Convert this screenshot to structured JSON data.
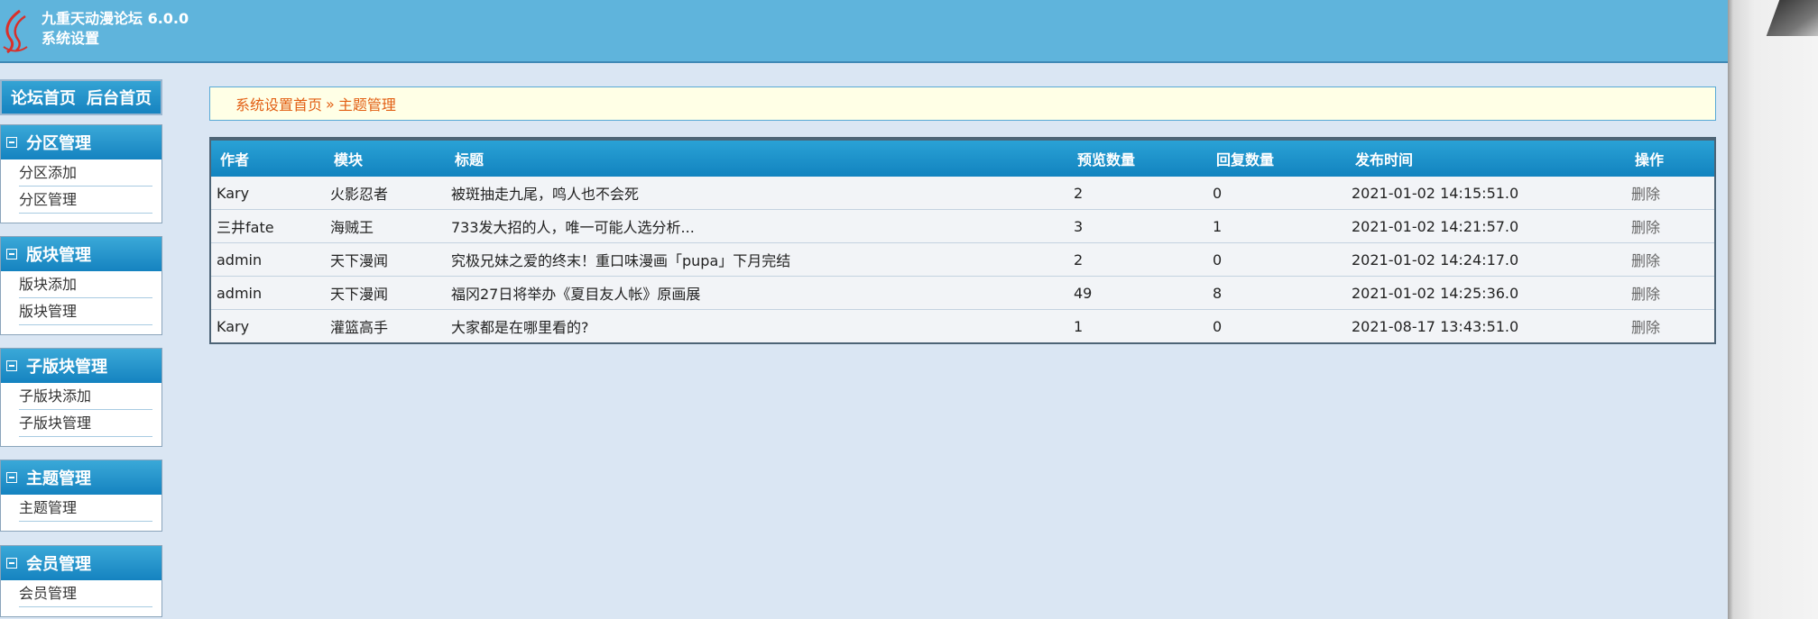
{
  "header": {
    "app_name": "九重天动漫论坛 6.0.0",
    "subtitle": "系统设置"
  },
  "top_links": [
    "论坛首页",
    "后台首页"
  ],
  "sidebar": {
    "groups": [
      {
        "title": "分区管理",
        "items": [
          "分区添加",
          "分区管理"
        ]
      },
      {
        "title": "版块管理",
        "items": [
          "版块添加",
          "版块管理"
        ]
      },
      {
        "title": "子版块管理",
        "items": [
          "子版块添加",
          "子版块管理"
        ]
      },
      {
        "title": "主题管理",
        "items": [
          "主题管理"
        ]
      },
      {
        "title": "会员管理",
        "items": [
          "会员管理"
        ]
      }
    ]
  },
  "breadcrumb": {
    "home": "系统设置首页",
    "separator": "»",
    "current": "主题管理"
  },
  "table": {
    "headers": [
      "作者",
      "模块",
      "标题",
      "预览数量",
      "回复数量",
      "发布时间",
      "操作"
    ],
    "rows": [
      [
        "Kary",
        "火影忍者",
        "被斑抽走九尾，鸣人也不会死",
        "2",
        "0",
        "2021-01-02 14:15:51.0",
        "删除"
      ],
      [
        "三井fate",
        "海贼王",
        "733发大招的人，唯一可能人选分析...",
        "3",
        "1",
        "2021-01-02 14:21:57.0",
        "删除"
      ],
      [
        "admin",
        "天下漫闻",
        "究极兄妹之爱的终末！重口味漫画「pupa」下月完结",
        "2",
        "0",
        "2021-01-02 14:24:17.0",
        "删除"
      ],
      [
        "admin",
        "天下漫闻",
        "福冈27日将举办《夏目友人帐》原画展",
        "49",
        "8",
        "2021-01-02 14:25:36.0",
        "删除"
      ],
      [
        "Kary",
        "灌篮高手",
        "大家都是在哪里看的?",
        "1",
        "0",
        "2021-08-17 13:43:51.0",
        "删除"
      ]
    ]
  },
  "colors": {
    "header_bg": "#5fb4dc",
    "page_bg": "#dae6f3",
    "accent_blue": "#1583c0",
    "breadcrumb_text": "#e25e12"
  }
}
